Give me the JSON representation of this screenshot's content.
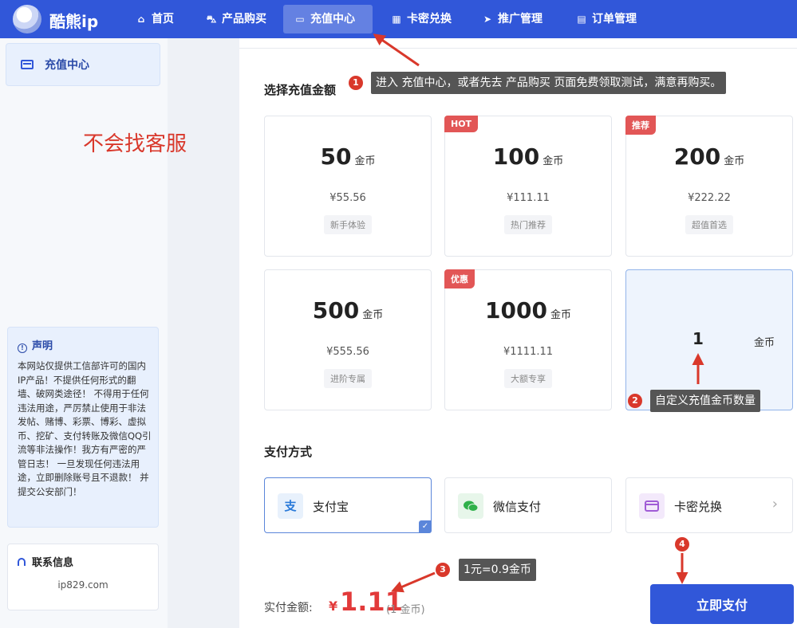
{
  "brand": {
    "name": "酷熊ip"
  },
  "nav": [
    {
      "label": "首页",
      "icon": "home-icon"
    },
    {
      "label": "产品购买",
      "icon": "cart-icon"
    },
    {
      "label": "充值中心",
      "icon": "wallet-icon",
      "active": true
    },
    {
      "label": "卡密兑换",
      "icon": "gift-icon"
    },
    {
      "label": "推广管理",
      "icon": "send-icon"
    },
    {
      "label": "订单管理",
      "icon": "document-icon"
    }
  ],
  "sidebar": {
    "active_item": "充值中心",
    "overlay_text": "不会找客服",
    "notice": {
      "title": "声明",
      "body": "本网站仅提供工信部许可的国内IP产品！不提供任何形式的翻墙、破网类途径！ 不得用于任何违法用途，严厉禁止使用于非法发帖、赌博、彩票、博彩、虚拟币、挖矿、支付转账及微信QQ引流等非法操作！我方有严密的严管日志！ 一旦发现任何违法用途，立即删除账号且不退款！ 并提交公安部门！"
    },
    "contact": {
      "title": "联系信息",
      "value": "ip829.com"
    }
  },
  "recharge": {
    "section_title": "选择充值金额",
    "unit": "金币",
    "cards": [
      {
        "amount": "50",
        "price": "¥55.56",
        "tag": "新手体验",
        "badge": ""
      },
      {
        "amount": "100",
        "price": "¥111.11",
        "tag": "热门推荐",
        "badge": "HOT"
      },
      {
        "amount": "200",
        "price": "¥222.22",
        "tag": "超值首选",
        "badge": "推荐"
      },
      {
        "amount": "500",
        "price": "¥555.56",
        "tag": "进阶专属",
        "badge": ""
      },
      {
        "amount": "1000",
        "price": "¥1111.11",
        "tag": "大额专享",
        "badge": "优惠"
      }
    ],
    "custom": {
      "value": "1",
      "unit": "金币"
    }
  },
  "payment": {
    "section_title": "支付方式",
    "methods": [
      {
        "label": "支付宝",
        "icon": "alipay-icon",
        "icon_glyph": "支",
        "selected": true
      },
      {
        "label": "微信支付",
        "icon": "wechat-icon",
        "icon_glyph": "",
        "selected": false
      },
      {
        "label": "卡密兑换",
        "icon": "card-icon",
        "icon_glyph": "",
        "selected": false
      }
    ]
  },
  "total": {
    "label": "实付金额:",
    "currency": "¥",
    "amount": "1.11",
    "coins": "(1 金币)",
    "button": "立即支付"
  },
  "annotations": [
    {
      "num": "1",
      "text": "进入 充值中心，或者先去 产品购买 页面免费领取测试，满意再购买。"
    },
    {
      "num": "2",
      "text": "自定义充值金币数量"
    },
    {
      "num": "3",
      "text": "1元=0.9金币"
    },
    {
      "num": "4",
      "text": ""
    }
  ],
  "colors": {
    "primary": "#3157d9",
    "danger": "#e23a3a",
    "badge": "#e25656",
    "annotation_bg": "#555555",
    "annotation_num": "#d9382b"
  }
}
